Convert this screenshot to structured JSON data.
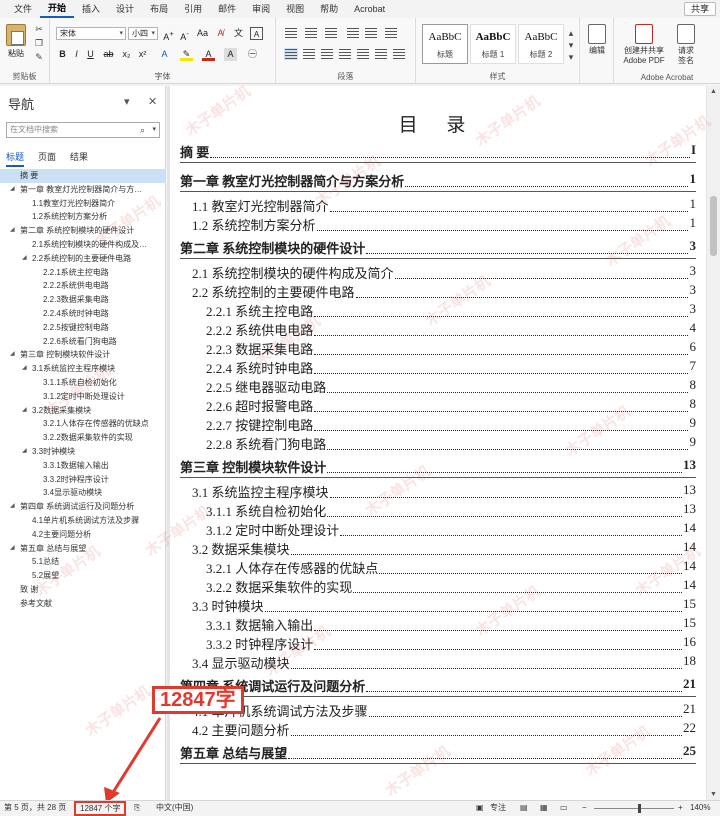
{
  "menu": {
    "tabs": [
      "文件",
      "开始",
      "插入",
      "设计",
      "布局",
      "引用",
      "邮件",
      "审阅",
      "视图",
      "帮助",
      "Acrobat"
    ],
    "active_tab": "开始",
    "share_label": "共享"
  },
  "ribbon": {
    "clipboard": {
      "paste_label": "粘贴",
      "group_label": "剪贴板"
    },
    "font": {
      "font_name": "宋体",
      "font_size": "小四",
      "group_label": "字体"
    },
    "paragraph": {
      "group_label": "段落"
    },
    "styles": {
      "items": [
        {
          "sample": "AaBbC",
          "name": "标题"
        },
        {
          "sample": "AaBbC",
          "name": "标题 1"
        },
        {
          "sample": "AaBbC",
          "name": "标题 2"
        }
      ],
      "group_label": "样式"
    },
    "editing": {
      "label": "编辑"
    },
    "adobe": {
      "create_label": "创建并共享",
      "create_label2": "Adobe PDF",
      "sign_label": "请求",
      "sign_label2": "签名",
      "group_label": "Adobe Acrobat"
    }
  },
  "nav": {
    "title": "导航",
    "search_placeholder": "在文档中搜索",
    "tabs": [
      "标题",
      "页面",
      "结果"
    ],
    "items": [
      {
        "label": "摘  要",
        "level": 1,
        "selected": true,
        "arrow": false
      },
      {
        "label": "第一章  教室灯光控制器简介与方…",
        "level": 1,
        "arrow": true
      },
      {
        "label": "1.1教室灯光控制器简介",
        "level": 2,
        "arrow": false
      },
      {
        "label": "1.2系统控制方案分析",
        "level": 2,
        "arrow": false
      },
      {
        "label": "第二章  系统控制模块的硬件设计",
        "level": 1,
        "arrow": true
      },
      {
        "label": "2.1系统控制模块的硬件构成及…",
        "level": 2,
        "arrow": false
      },
      {
        "label": "2.2系统控制的主要硬件电路",
        "level": 2,
        "arrow": true
      },
      {
        "label": "2.2.1系统主控电路",
        "level": 3,
        "arrow": false
      },
      {
        "label": "2.2.2系统供电电路",
        "level": 3,
        "arrow": false
      },
      {
        "label": "2.2.3数据采集电路",
        "level": 3,
        "arrow": false
      },
      {
        "label": "2.2.4系统时钟电路",
        "level": 3,
        "arrow": false
      },
      {
        "label": "2.2.5按键控制电路",
        "level": 3,
        "arrow": false
      },
      {
        "label": "2.2.6系统看门狗电路",
        "level": 3,
        "arrow": false
      },
      {
        "label": "第三章  控制模块软件设计",
        "level": 1,
        "arrow": true
      },
      {
        "label": "3.1系统监控主程序模块",
        "level": 2,
        "arrow": true
      },
      {
        "label": "3.1.1系统自检初始化",
        "level": 3,
        "arrow": false
      },
      {
        "label": "3.1.2定时中断处理设计",
        "level": 3,
        "arrow": false
      },
      {
        "label": "3.2数据采集模块",
        "level": 2,
        "arrow": true
      },
      {
        "label": "3.2.1人体存在传感器的优缺点",
        "level": 3,
        "arrow": false
      },
      {
        "label": "3.2.2数据采集软件的实现",
        "level": 3,
        "arrow": false
      },
      {
        "label": "3.3时钟模块",
        "level": 2,
        "arrow": true
      },
      {
        "label": "3.3.1数据输入输出",
        "level": 3,
        "arrow": false
      },
      {
        "label": "3.3.2时钟程序设计",
        "level": 3,
        "arrow": false
      },
      {
        "label": "3.4显示驱动模块",
        "level": 3,
        "arrow": false
      },
      {
        "label": "第四章  系统调试运行及问题分析",
        "level": 1,
        "arrow": true
      },
      {
        "label": "4.1单片机系统调试方法及步骤",
        "level": 2,
        "arrow": false
      },
      {
        "label": "4.2主要问题分析",
        "level": 2,
        "arrow": false
      },
      {
        "label": "第五章  总结与展望",
        "level": 1,
        "arrow": true
      },
      {
        "label": "5.1总结",
        "level": 2,
        "arrow": false
      },
      {
        "label": "5.2展望",
        "level": 2,
        "arrow": false
      },
      {
        "label": "致  谢",
        "level": 1,
        "arrow": false
      },
      {
        "label": "参考文献",
        "level": 1,
        "arrow": false
      }
    ]
  },
  "document": {
    "toc_title": "目  录",
    "entries": [
      {
        "text": "摘    要",
        "page": "I",
        "kind": "ch"
      },
      {
        "text": "第一章  教室灯光控制器简介与方案分析",
        "page": "1",
        "kind": "ch"
      },
      {
        "text": "1.1 教室灯光控制器简介",
        "page": "1",
        "kind": "s2"
      },
      {
        "text": "1.2 系统控制方案分析",
        "page": "1",
        "kind": "s2"
      },
      {
        "text": "第二章  系统控制模块的硬件设计",
        "page": "3",
        "kind": "ch"
      },
      {
        "text": "2.1 系统控制模块的硬件构成及简介",
        "page": "3",
        "kind": "s2"
      },
      {
        "text": "2.2 系统控制的主要硬件电路",
        "page": "3",
        "kind": "s2"
      },
      {
        "text": "2.2.1 系统主控电路",
        "page": "3",
        "kind": "s3"
      },
      {
        "text": "2.2.2 系统供电电路",
        "page": "4",
        "kind": "s3"
      },
      {
        "text": "2.2.3 数据采集电路",
        "page": "6",
        "kind": "s3"
      },
      {
        "text": "2.2.4 系统时钟电路",
        "page": "7",
        "kind": "s3"
      },
      {
        "text": "2.2.5 继电器驱动电路",
        "page": "8",
        "kind": "s3"
      },
      {
        "text": "2.2.6 超时报警电路",
        "page": "8",
        "kind": "s3"
      },
      {
        "text": "2.2.7 按键控制电路",
        "page": "9",
        "kind": "s3"
      },
      {
        "text": "2.2.8 系统看门狗电路",
        "page": "9",
        "kind": "s3"
      },
      {
        "text": "第三章  控制模块软件设计",
        "page": "13",
        "kind": "ch"
      },
      {
        "text": "3.1 系统监控主程序模块",
        "page": "13",
        "kind": "s2"
      },
      {
        "text": "3.1.1 系统自检初始化",
        "page": "13",
        "kind": "s3"
      },
      {
        "text": "3.1.2 定时中断处理设计",
        "page": "14",
        "kind": "s3"
      },
      {
        "text": "3.2 数据采集模块",
        "page": "14",
        "kind": "s2"
      },
      {
        "text": "3.2.1 人体存在传感器的优缺点",
        "page": "14",
        "kind": "s3"
      },
      {
        "text": "3.2.2 数据采集软件的实现",
        "page": "14",
        "kind": "s3"
      },
      {
        "text": "3.3 时钟模块",
        "page": "15",
        "kind": "s2"
      },
      {
        "text": "3.3.1 数据输入输出",
        "page": "15",
        "kind": "s3"
      },
      {
        "text": "3.3.2 时钟程序设计",
        "page": "16",
        "kind": "s3"
      },
      {
        "text": "3.4 显示驱动模块",
        "page": "18",
        "kind": "s2"
      },
      {
        "text": "第四章  系统调试运行及问题分析",
        "page": "21",
        "kind": "ch"
      },
      {
        "text": "4.1 单片机系统调试方法及步骤",
        "page": "21",
        "kind": "s2"
      },
      {
        "text": "4.2 主要问题分析",
        "page": "22",
        "kind": "s2"
      },
      {
        "text": "第五章  总结与展望",
        "page": "25",
        "kind": "ch"
      }
    ]
  },
  "watermark": "木子单片机",
  "callout": "12847字",
  "status": {
    "page": "第 5 页，共 28 页",
    "word_count": "12847 个字",
    "language": "中文(中国)",
    "focus": "专注",
    "zoom": "140%"
  },
  "colors": {
    "accent": "#185abd",
    "highlight_red": "#e03a2f",
    "nav_selected": "#cce0f5"
  }
}
